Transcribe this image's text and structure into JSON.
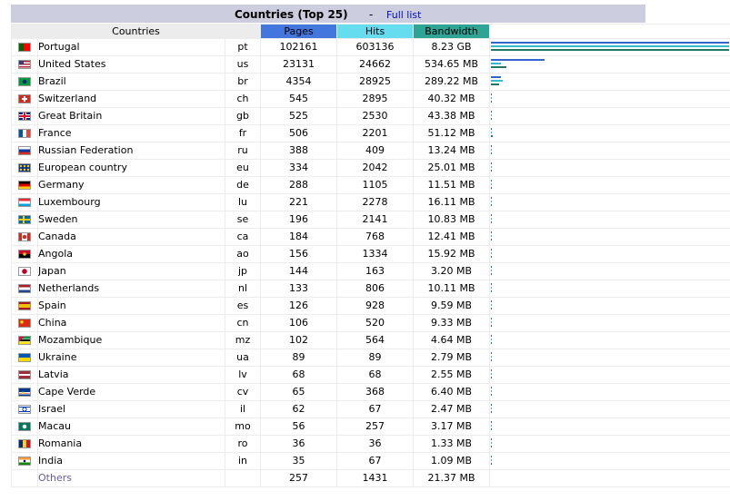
{
  "header": {
    "title": "Countries (Top 25)",
    "separator": "-",
    "full_list": "Full list"
  },
  "columns": {
    "countries": "Countries",
    "pages": "Pages",
    "hits": "Hits",
    "bandwidth": "Bandwidth"
  },
  "colors": {
    "pages": "#4477dd",
    "hits": "#66ddee",
    "bandwidth": "#2ea495"
  },
  "rows": [
    {
      "name": "Portugal",
      "code": "pt",
      "pages": "102161",
      "hits": "603136",
      "bandwidth": "8.23 GB",
      "flag": "portugal-flag-icon",
      "pages_n": 102161,
      "hits_n": 603136,
      "bw_mb": 8427.5
    },
    {
      "name": "United States",
      "code": "us",
      "pages": "23131",
      "hits": "24662",
      "bandwidth": "534.65 MB",
      "flag": "us-flag-icon",
      "pages_n": 23131,
      "hits_n": 24662,
      "bw_mb": 534.65
    },
    {
      "name": "Brazil",
      "code": "br",
      "pages": "4354",
      "hits": "28925",
      "bandwidth": "289.22 MB",
      "flag": "brazil-flag-icon",
      "pages_n": 4354,
      "hits_n": 28925,
      "bw_mb": 289.22
    },
    {
      "name": "Switzerland",
      "code": "ch",
      "pages": "545",
      "hits": "2895",
      "bandwidth": "40.32 MB",
      "flag": "switzerland-flag-icon",
      "pages_n": 545,
      "hits_n": 2895,
      "bw_mb": 40.32
    },
    {
      "name": "Great Britain",
      "code": "gb",
      "pages": "525",
      "hits": "2530",
      "bandwidth": "43.38 MB",
      "flag": "uk-flag-icon",
      "pages_n": 525,
      "hits_n": 2530,
      "bw_mb": 43.38
    },
    {
      "name": "France",
      "code": "fr",
      "pages": "506",
      "hits": "2201",
      "bandwidth": "51.12 MB",
      "flag": "france-flag-icon",
      "pages_n": 506,
      "hits_n": 2201,
      "bw_mb": 51.12
    },
    {
      "name": "Russian Federation",
      "code": "ru",
      "pages": "388",
      "hits": "409",
      "bandwidth": "13.24 MB",
      "flag": "russia-flag-icon",
      "pages_n": 388,
      "hits_n": 409,
      "bw_mb": 13.24
    },
    {
      "name": "European country",
      "code": "eu",
      "pages": "334",
      "hits": "2042",
      "bandwidth": "25.01 MB",
      "flag": "eu-flag-icon",
      "pages_n": 334,
      "hits_n": 2042,
      "bw_mb": 25.01
    },
    {
      "name": "Germany",
      "code": "de",
      "pages": "288",
      "hits": "1105",
      "bandwidth": "11.51 MB",
      "flag": "germany-flag-icon",
      "pages_n": 288,
      "hits_n": 1105,
      "bw_mb": 11.51
    },
    {
      "name": "Luxembourg",
      "code": "lu",
      "pages": "221",
      "hits": "2278",
      "bandwidth": "16.11 MB",
      "flag": "luxembourg-flag-icon",
      "pages_n": 221,
      "hits_n": 2278,
      "bw_mb": 16.11
    },
    {
      "name": "Sweden",
      "code": "se",
      "pages": "196",
      "hits": "2141",
      "bandwidth": "10.83 MB",
      "flag": "sweden-flag-icon",
      "pages_n": 196,
      "hits_n": 2141,
      "bw_mb": 10.83
    },
    {
      "name": "Canada",
      "code": "ca",
      "pages": "184",
      "hits": "768",
      "bandwidth": "12.41 MB",
      "flag": "canada-flag-icon",
      "pages_n": 184,
      "hits_n": 768,
      "bw_mb": 12.41
    },
    {
      "name": "Angola",
      "code": "ao",
      "pages": "156",
      "hits": "1334",
      "bandwidth": "15.92 MB",
      "flag": "angola-flag-icon",
      "pages_n": 156,
      "hits_n": 1334,
      "bw_mb": 15.92
    },
    {
      "name": "Japan",
      "code": "jp",
      "pages": "144",
      "hits": "163",
      "bandwidth": "3.20 MB",
      "flag": "japan-flag-icon",
      "pages_n": 144,
      "hits_n": 163,
      "bw_mb": 3.2
    },
    {
      "name": "Netherlands",
      "code": "nl",
      "pages": "133",
      "hits": "806",
      "bandwidth": "10.11 MB",
      "flag": "netherlands-flag-icon",
      "pages_n": 133,
      "hits_n": 806,
      "bw_mb": 10.11
    },
    {
      "name": "Spain",
      "code": "es",
      "pages": "126",
      "hits": "928",
      "bandwidth": "9.59 MB",
      "flag": "spain-flag-icon",
      "pages_n": 126,
      "hits_n": 928,
      "bw_mb": 9.59
    },
    {
      "name": "China",
      "code": "cn",
      "pages": "106",
      "hits": "520",
      "bandwidth": "9.33 MB",
      "flag": "china-flag-icon",
      "pages_n": 106,
      "hits_n": 520,
      "bw_mb": 9.33
    },
    {
      "name": "Mozambique",
      "code": "mz",
      "pages": "102",
      "hits": "564",
      "bandwidth": "4.64 MB",
      "flag": "mozambique-flag-icon",
      "pages_n": 102,
      "hits_n": 564,
      "bw_mb": 4.64
    },
    {
      "name": "Ukraine",
      "code": "ua",
      "pages": "89",
      "hits": "89",
      "bandwidth": "2.79 MB",
      "flag": "ukraine-flag-icon",
      "pages_n": 89,
      "hits_n": 89,
      "bw_mb": 2.79
    },
    {
      "name": "Latvia",
      "code": "lv",
      "pages": "68",
      "hits": "68",
      "bandwidth": "2.55 MB",
      "flag": "latvia-flag-icon",
      "pages_n": 68,
      "hits_n": 68,
      "bw_mb": 2.55
    },
    {
      "name": "Cape Verde",
      "code": "cv",
      "pages": "65",
      "hits": "368",
      "bandwidth": "6.40 MB",
      "flag": "cape-verde-flag-icon",
      "pages_n": 65,
      "hits_n": 368,
      "bw_mb": 6.4
    },
    {
      "name": "Israel",
      "code": "il",
      "pages": "62",
      "hits": "67",
      "bandwidth": "2.47 MB",
      "flag": "israel-flag-icon",
      "pages_n": 62,
      "hits_n": 67,
      "bw_mb": 2.47
    },
    {
      "name": "Macau",
      "code": "mo",
      "pages": "56",
      "hits": "257",
      "bandwidth": "3.17 MB",
      "flag": "macau-flag-icon",
      "pages_n": 56,
      "hits_n": 257,
      "bw_mb": 3.17
    },
    {
      "name": "Romania",
      "code": "ro",
      "pages": "36",
      "hits": "36",
      "bandwidth": "1.33 MB",
      "flag": "romania-flag-icon",
      "pages_n": 36,
      "hits_n": 36,
      "bw_mb": 1.33
    },
    {
      "name": "India",
      "code": "in",
      "pages": "35",
      "hits": "67",
      "bandwidth": "1.09 MB",
      "flag": "india-flag-icon",
      "pages_n": 35,
      "hits_n": 67,
      "bw_mb": 1.09
    }
  ],
  "others": {
    "name": "Others",
    "pages": "257",
    "hits": "1431",
    "bandwidth": "21.37 MB"
  }
}
